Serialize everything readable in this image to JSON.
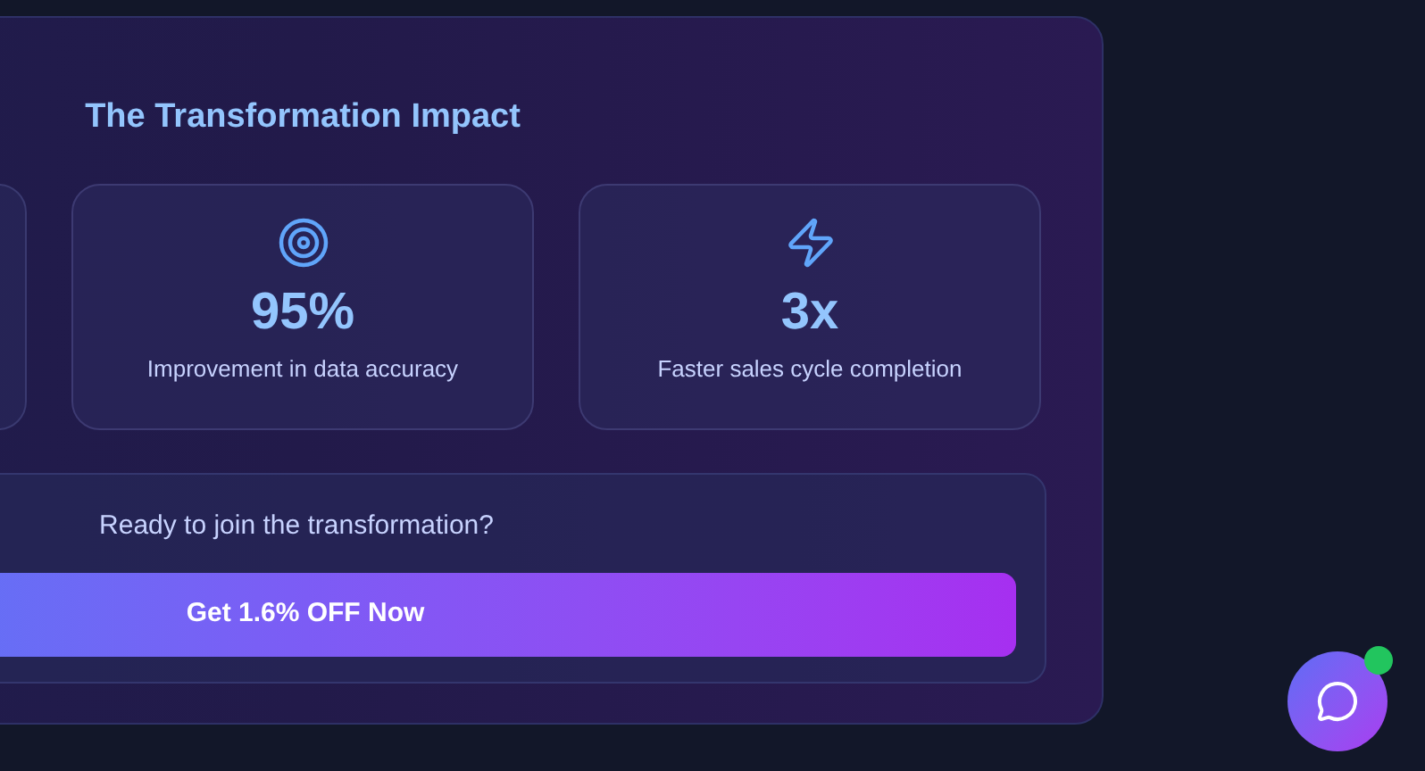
{
  "impact": {
    "title": "The Transformation Impact",
    "stats": [
      {
        "kind": "target",
        "value": "95%",
        "label": "Improvement in data accuracy"
      },
      {
        "kind": "zap",
        "value": "3x",
        "label": "Faster sales cycle completion"
      }
    ]
  },
  "cta": {
    "question": "Ready to join the transformation?",
    "button": "Get 1.6% OFF Now"
  },
  "chat": {
    "online": true
  }
}
